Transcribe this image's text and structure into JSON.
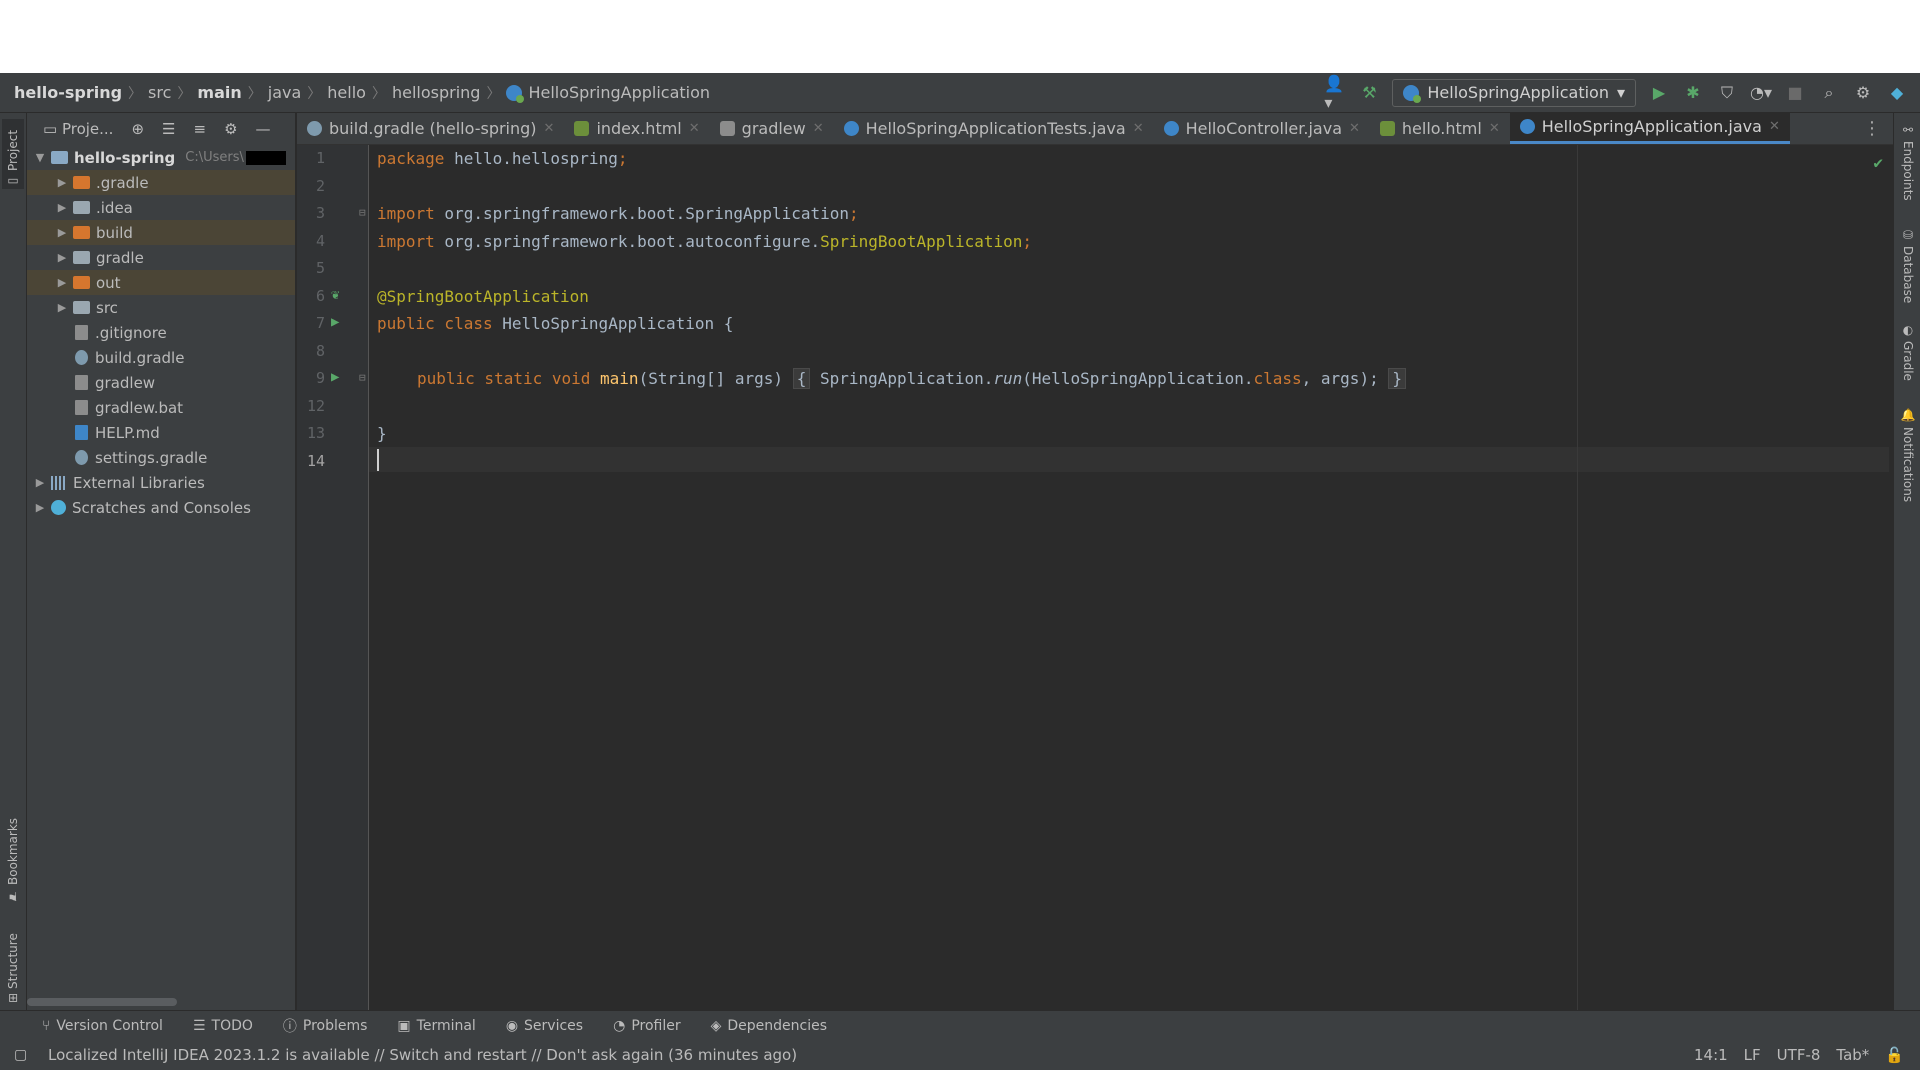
{
  "breadcrumbs": [
    "hello-spring",
    "src",
    "main",
    "java",
    "hello",
    "hellospring",
    "HelloSpringApplication"
  ],
  "toolbar": {
    "run_config": "HelloSpringApplication",
    "user_icon": "user-icon",
    "build_icon": "hammer-icon",
    "run_icon": "play-icon",
    "debug_icon": "bug-icon",
    "coverage_icon": "shield-icon",
    "profiler_icon": "profiler-icon",
    "stop_icon": "stop-icon",
    "search_icon": "search-icon",
    "settings_icon": "gear-icon",
    "logo_icon": "ide-logo-icon"
  },
  "left_strip": {
    "project": "Project",
    "bookmarks": "Bookmarks",
    "structure": "Structure"
  },
  "right_strip": {
    "endpoints": "Endpoints",
    "database": "Database",
    "gradle": "Gradle",
    "notifications": "Notifications"
  },
  "project_panel": {
    "title": "Proje...",
    "root": {
      "name": "hello-spring",
      "path": "C:\\Users\\"
    },
    "items": [
      {
        "name": ".gradle",
        "type": "folder",
        "color": "orange"
      },
      {
        "name": ".idea",
        "type": "folder",
        "color": "gray"
      },
      {
        "name": "build",
        "type": "folder",
        "color": "orange"
      },
      {
        "name": "gradle",
        "type": "folder",
        "color": "gray"
      },
      {
        "name": "out",
        "type": "folder",
        "color": "orange"
      },
      {
        "name": "src",
        "type": "folder",
        "color": "gray"
      },
      {
        "name": ".gitignore",
        "type": "file"
      },
      {
        "name": "build.gradle",
        "type": "gradle"
      },
      {
        "name": "gradlew",
        "type": "file"
      },
      {
        "name": "gradlew.bat",
        "type": "file"
      },
      {
        "name": "HELP.md",
        "type": "md"
      },
      {
        "name": "settings.gradle",
        "type": "gradle"
      }
    ],
    "external_libraries": "External Libraries",
    "scratches": "Scratches and Consoles"
  },
  "tabs": [
    {
      "label": "build.gradle (hello-spring)",
      "icon": "gradle"
    },
    {
      "label": "index.html",
      "icon": "html"
    },
    {
      "label": "gradlew",
      "icon": "sh"
    },
    {
      "label": "HelloSpringApplicationTests.java",
      "icon": "java"
    },
    {
      "label": "HelloController.java",
      "icon": "java"
    },
    {
      "label": "hello.html",
      "icon": "html"
    },
    {
      "label": "HelloSpringApplication.java",
      "icon": "java",
      "active": true
    }
  ],
  "line_numbers": [
    "1",
    "2",
    "3",
    "4",
    "5",
    "6",
    "7",
    "8",
    "9",
    "12",
    "13",
    "14"
  ],
  "code": {
    "l1_kw": "package",
    "l1_rest": " hello.hellospring",
    "l1_semi": ";",
    "l3_kw": "import",
    "l3_rest": " org.springframework.boot.SpringApplication",
    "l3_semi": ";",
    "l4_kw": "import",
    "l4_rest": " org.springframework.boot.autoconfigure.",
    "l4_ann": "SpringBootApplication",
    "l4_semi": ";",
    "l6_ann": "@SpringBootApplication",
    "l7_kw": "public class",
    "l7_rest": " HelloSpringApplication {",
    "l9_kw": "public static void",
    "l9_fn": " main",
    "l9_args": "(String[] args)",
    "l9_open": "{",
    "l9_call": " SpringApplication.",
    "l9_run": "run",
    "l9_params": "(HelloSpringApplication.",
    "l9_class": "class",
    "l9_end": ", args);",
    "l9_close": "}",
    "l13": "}"
  },
  "bottom_tools": [
    "Version Control",
    "TODO",
    "Problems",
    "Terminal",
    "Services",
    "Profiler",
    "Dependencies"
  ],
  "status": {
    "message": "Localized IntelliJ IDEA 2023.1.2 is available // Switch and restart // Don't ask again (36 minutes ago)",
    "position": "14:1",
    "line_sep": "LF",
    "encoding": "UTF-8",
    "indent": "Tab*"
  },
  "colors": {
    "keyword": "#cc7832",
    "annotation": "#bbb529",
    "function": "#ffc66d",
    "accent": "#4a88c7",
    "run_green": "#59a869"
  }
}
